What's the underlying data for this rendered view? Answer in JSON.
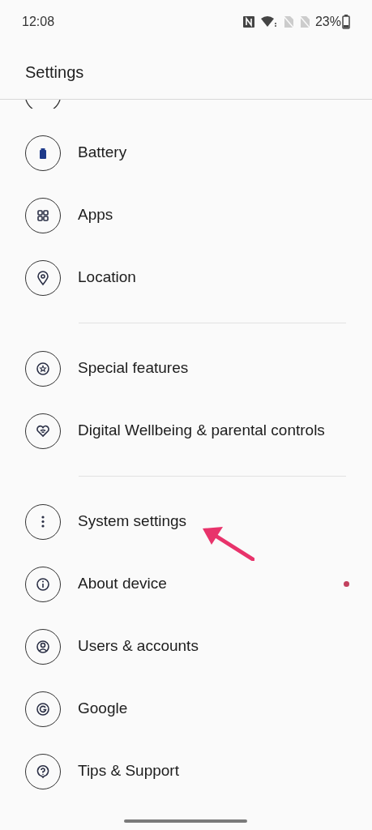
{
  "status_bar": {
    "time": "12:08",
    "battery_percent": "23%"
  },
  "header": {
    "title": "Settings"
  },
  "sections": [
    {
      "items": [
        {
          "label": "Battery",
          "notification_dot": false
        },
        {
          "label": "Apps",
          "notification_dot": false
        },
        {
          "label": "Location",
          "notification_dot": false
        }
      ]
    },
    {
      "items": [
        {
          "label": "Special features",
          "notification_dot": false
        },
        {
          "label": "Digital Wellbeing & parental controls",
          "notification_dot": false
        }
      ]
    },
    {
      "items": [
        {
          "label": "System settings",
          "notification_dot": false
        },
        {
          "label": "About device",
          "notification_dot": true
        },
        {
          "label": "Users & accounts",
          "notification_dot": false
        },
        {
          "label": "Google",
          "notification_dot": false
        },
        {
          "label": "Tips & Support",
          "notification_dot": false
        }
      ]
    }
  ]
}
